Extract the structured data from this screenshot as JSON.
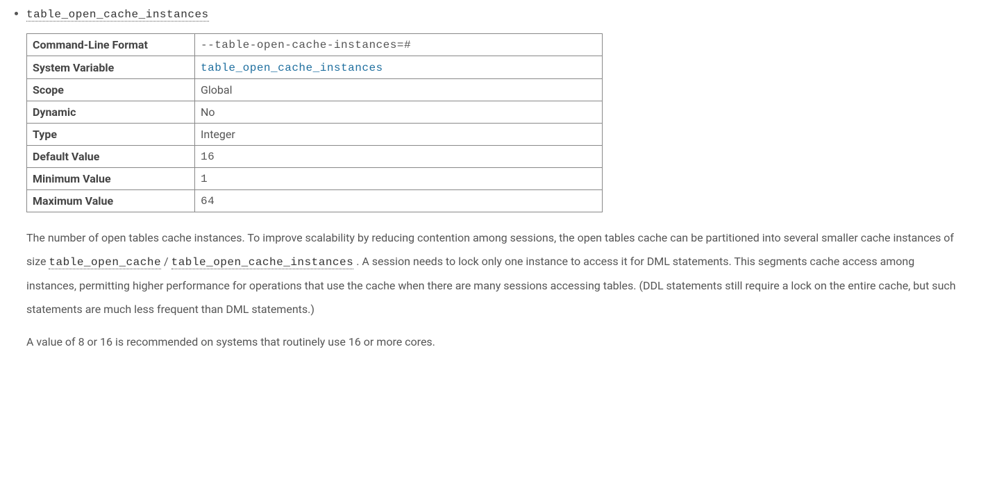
{
  "heading_link": "table_open_cache_instances",
  "table": {
    "rows": [
      {
        "label": "Command-Line Format",
        "value": "--table-open-cache-instances=#",
        "mono": true,
        "link": false
      },
      {
        "label": "System Variable",
        "value": "table_open_cache_instances",
        "mono": true,
        "link": true
      },
      {
        "label": "Scope",
        "value": "Global",
        "mono": false,
        "link": false
      },
      {
        "label": "Dynamic",
        "value": "No",
        "mono": false,
        "link": false
      },
      {
        "label": "Type",
        "value": "Integer",
        "mono": false,
        "link": false
      },
      {
        "label": "Default Value",
        "value": "16",
        "mono": true,
        "link": false
      },
      {
        "label": "Minimum Value",
        "value": "1",
        "mono": true,
        "link": false
      },
      {
        "label": "Maximum Value",
        "value": "64",
        "mono": true,
        "link": false
      }
    ]
  },
  "para1": {
    "t1": "The number of open tables cache instances. To improve scalability by reducing contention among sessions, the open tables cache can be partitioned into several smaller cache instances of size ",
    "l1": "table_open_cache",
    "sep": " / ",
    "l2": "table_open_cache_instances",
    "t2": " . A session needs to lock only one instance to access it for DML statements. This segments cache access among instances, permitting higher performance for operations that use the cache when there are many sessions accessing tables. (DDL statements still require a lock on the entire cache, but such statements are much less frequent than DML statements.)"
  },
  "para2": "A value of 8 or 16 is recommended on systems that routinely use 16 or more cores."
}
